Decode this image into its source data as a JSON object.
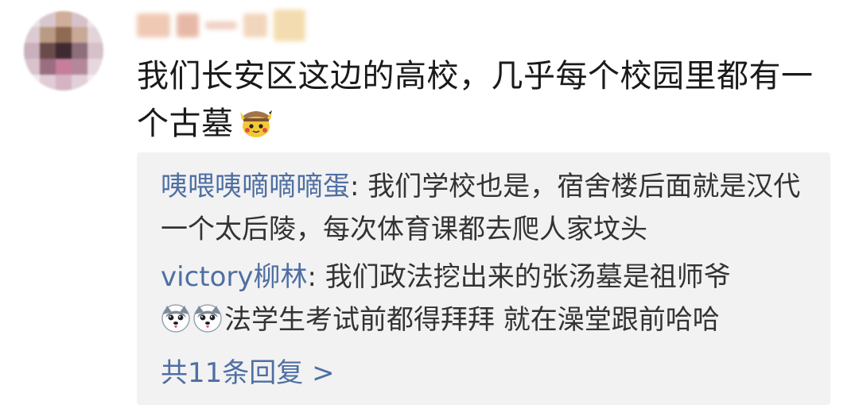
{
  "comment": {
    "text": "我们长安区这边的高校，几乎每个校园里都有一个古墓",
    "emoji": "detective-pikachu-emoji"
  },
  "replies": [
    {
      "name": "咦喂咦嘀嘀嘀蛋",
      "separator": ": ",
      "text": "我们学校也是，宿舍楼后面就是汉代一个太后陵，每次体育课都去爬人家坟头"
    },
    {
      "name": "victory柳林",
      "separator": ": ",
      "text_before_emoji": "我们政法挖出来的张汤墓是祖师爷",
      "emoji": "husky-emoji",
      "text_after_emoji": "法学生考试前都得拜拜 就在澡堂跟前哈哈"
    }
  ],
  "more_replies_label": "共11条回复 >",
  "colors": {
    "link": "#4f6fa3",
    "text": "#1a1a1a",
    "reply_bg": "#f2f2f2"
  }
}
